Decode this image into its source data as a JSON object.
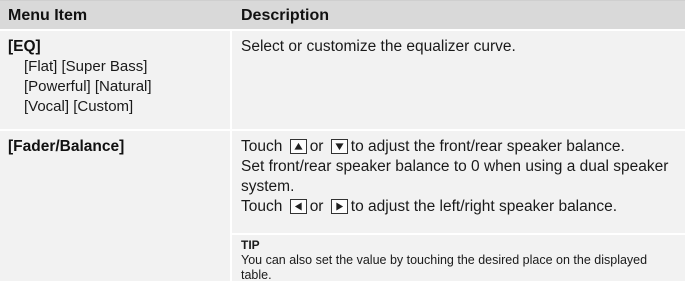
{
  "table": {
    "headers": {
      "menu_item": "Menu Item",
      "description": "Description"
    },
    "rows": [
      {
        "menu_item": "[EQ]",
        "options": [
          "[Flat] [Super Bass]",
          "[Powerful] [Natural]",
          "[Vocal] [Custom]"
        ],
        "description": "Select or customize the equalizer curve."
      },
      {
        "menu_item": "[Fader/Balance]",
        "line1_touch": "Touch",
        "line1_or": "or",
        "line1_rest": "to adjust the front/rear speaker balance.",
        "line2": "Set front/rear speaker balance to 0 when using a dual speaker system.",
        "line3_touch": "Touch",
        "line3_or": "or",
        "line3_rest": "to adjust the left/right speaker balance.",
        "tip_title": "TIP",
        "tip_text": "You can also set the value by touching the desired place on the displayed table."
      }
    ]
  },
  "icons": {
    "up": "up-arrow-button-icon",
    "down": "down-arrow-button-icon",
    "left": "left-arrow-button-icon",
    "right": "right-arrow-button-icon"
  }
}
